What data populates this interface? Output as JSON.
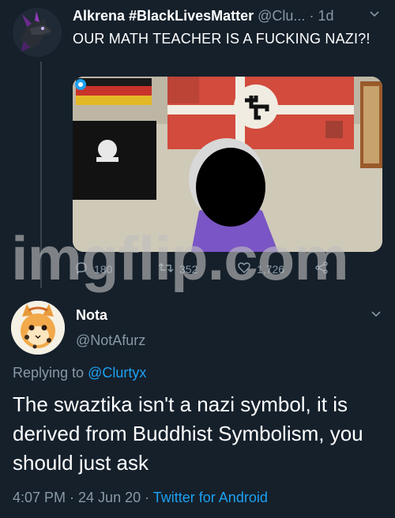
{
  "tweet1": {
    "display_name": "Alkrena #BlackLivesMatter",
    "handle": "@Clu...",
    "separator": "·",
    "time": "1d",
    "text": "OUR MATH TEACHER IS A FUCKING NAZI?!",
    "actions": {
      "replies": "180",
      "retweets": "352",
      "likes": "1,726"
    }
  },
  "watermark": "imgflip.com",
  "tweet2": {
    "display_name": "Nota",
    "handle": "@NotAfurz",
    "replying_prefix": "Replying to",
    "replying_to": "@Clurtyx",
    "text": "The swaztika isn't a nazi symbol, it is derived from Buddhist Symbolism, you should just ask",
    "timestamp": "4:07 PM · 24 Jun 20 ·",
    "source": "Twitter for Android"
  },
  "colors": {
    "background": "#15202b",
    "secondary_text": "#8899a6",
    "link": "#1da1f2",
    "thread_line": "#38444d"
  }
}
